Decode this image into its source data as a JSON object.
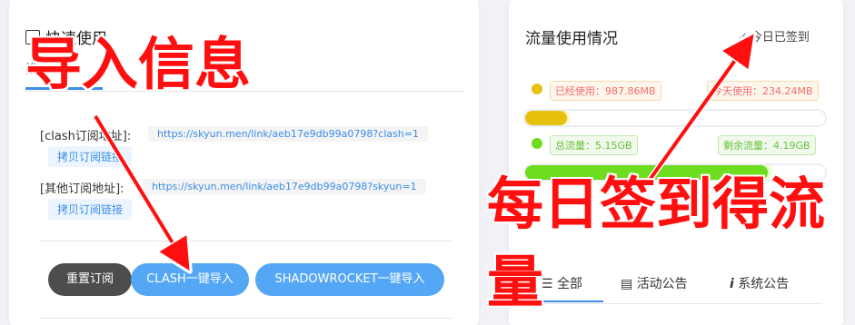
{
  "quick_use": {
    "title": "快速使用",
    "tab_label": "推",
    "clash_label": "[clash订阅地址]:",
    "clash_url": "https://skyun.men/link/aeb17e9db99a0798?clash=1",
    "clash_copy": "拷贝订阅链接",
    "other_label": "[其他订阅地址]:",
    "other_url": "https://skyun.men/link/aeb17e9db99a0798?skyun=1",
    "other_copy": "拷贝订阅链接",
    "buttons": {
      "reset": "重置订阅",
      "clash_import": "CLASH一键导入",
      "shadowrocket_import": "SHADOWROCKET一键导入"
    }
  },
  "traffic": {
    "title": "流量使用情况",
    "signed_label": "今日已签到",
    "used_total": "已经使用：987.86MB",
    "used_today": "今天使用：234.24MB",
    "used_fraction": 0.14,
    "total": "总流量：5.15GB",
    "remaining": "剩余流量：4.19GB",
    "remaining_fraction": 0.81,
    "colors": {
      "used": "#e6c20f",
      "remaining": "#6edc1f"
    }
  },
  "announcements": {
    "tabs": [
      "全部",
      "活动公告",
      "系统公告"
    ]
  },
  "overlays": {
    "import_info": "导入信息",
    "checkin_reward_line1": "每日签到得流",
    "checkin_reward_line2": "量"
  }
}
